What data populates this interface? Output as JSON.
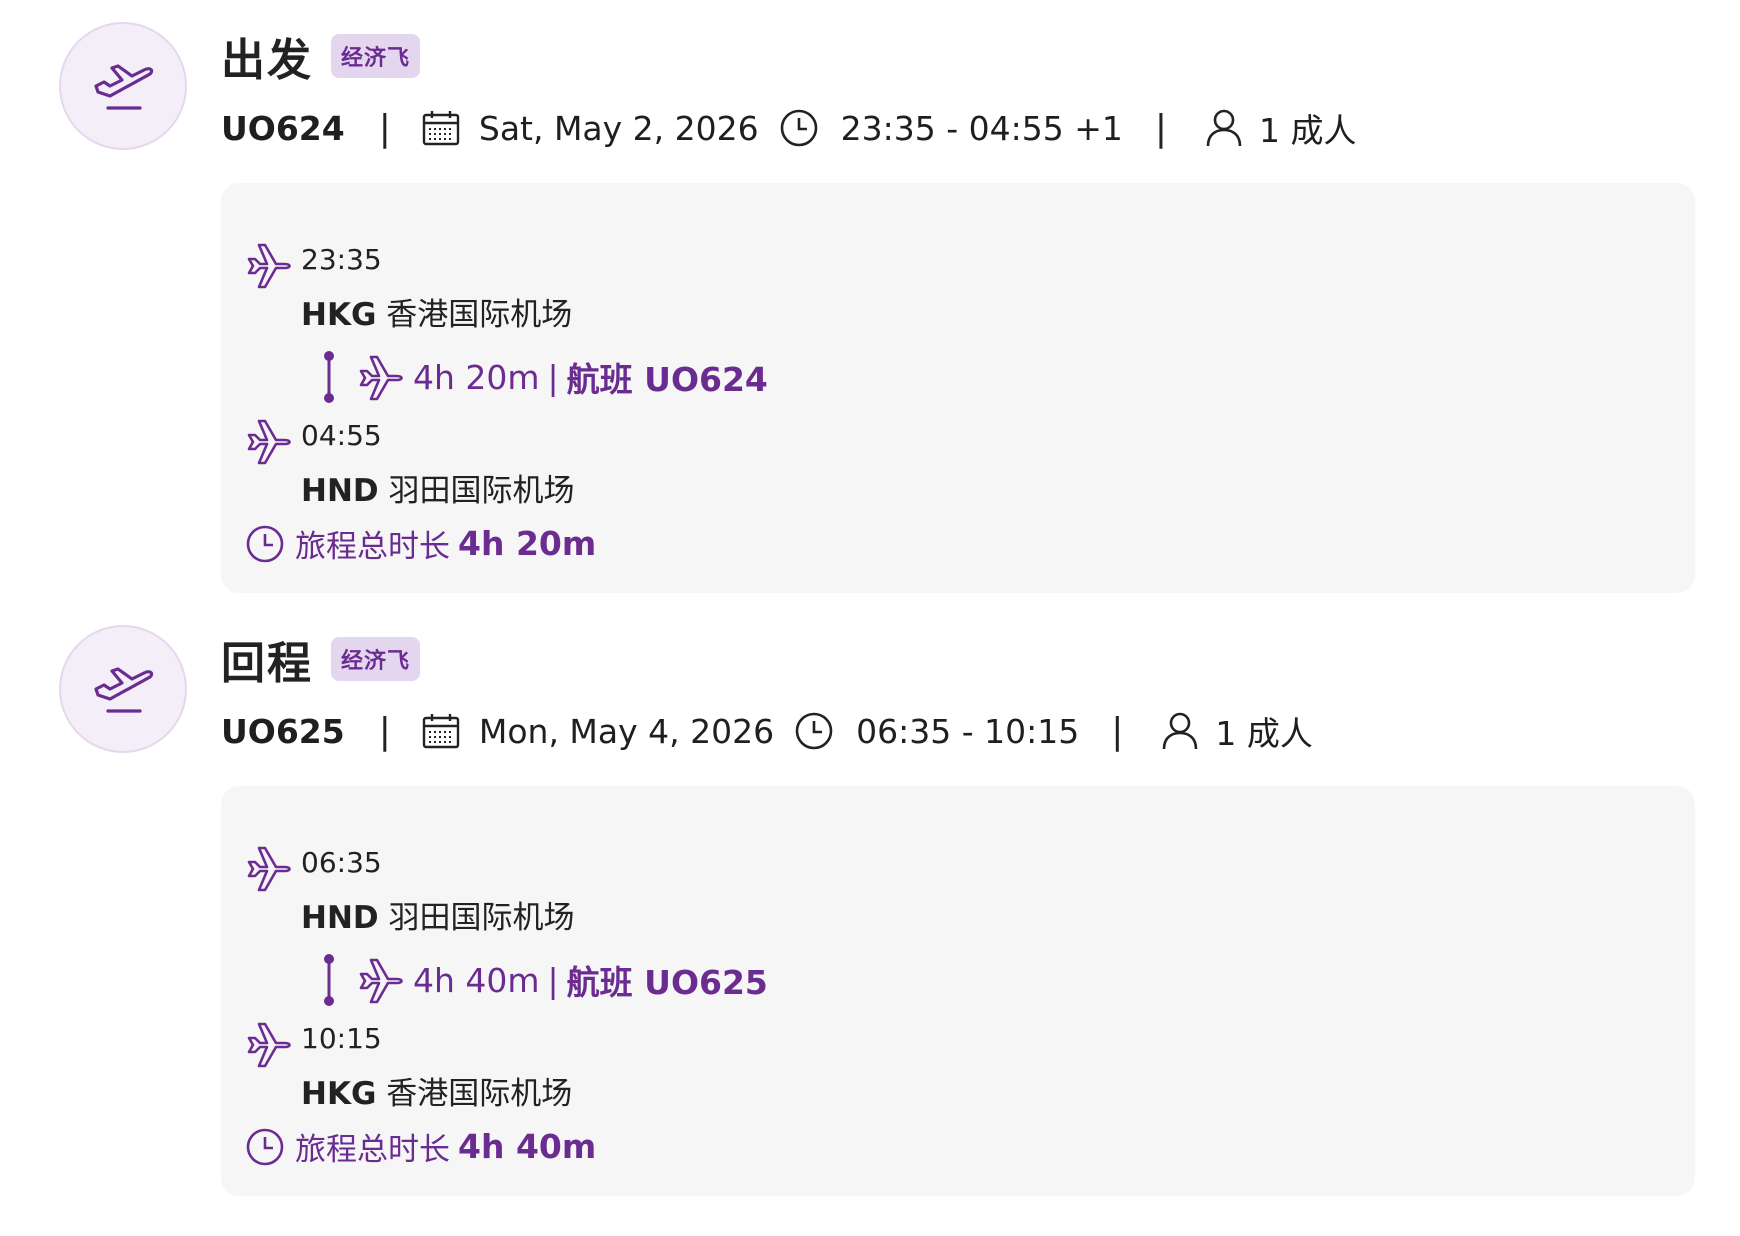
{
  "legs": [
    {
      "title": "出发",
      "badge": "经济飞",
      "flight_no": "UO624",
      "date": "Sat, May 2, 2026",
      "time_range": "23:35 - 04:55 +1",
      "passengers": "1 成人",
      "dep_time": "23:35",
      "dep_code": "HKG",
      "dep_airport": "香港国际机场",
      "duration": "4h 20m",
      "dur_sep": "|",
      "flight_label": "航班 UO624",
      "arr_time": "04:55",
      "arr_code": "HND",
      "arr_airport": "羽田国际机场",
      "total_label": "旅程总时长",
      "total_value": "4h 20m"
    },
    {
      "title": "回程",
      "badge": "经济飞",
      "flight_no": "UO625",
      "date": "Mon, May 4, 2026",
      "time_range": "06:35 - 10:15",
      "passengers": "1 成人",
      "dep_time": "06:35",
      "dep_code": "HND",
      "dep_airport": "羽田国际机场",
      "duration": "4h 40m",
      "dur_sep": "|",
      "flight_label": "航班 UO625",
      "arr_time": "10:15",
      "arr_code": "HKG",
      "arr_airport": "香港国际机场",
      "total_label": "旅程总时长",
      "total_value": "4h 40m"
    }
  ],
  "separator": "|",
  "colors": {
    "accent": "#6a2c91",
    "badge_bg": "#e5d6ef",
    "card_bg": "#f6f6f6",
    "circle_bg": "#f4eef8"
  },
  "icons": {
    "leg": "takeoff-icon",
    "date": "calendar-icon",
    "time": "clock-icon",
    "pax": "person-icon",
    "segment": "plane-icon",
    "total": "clock-icon"
  }
}
